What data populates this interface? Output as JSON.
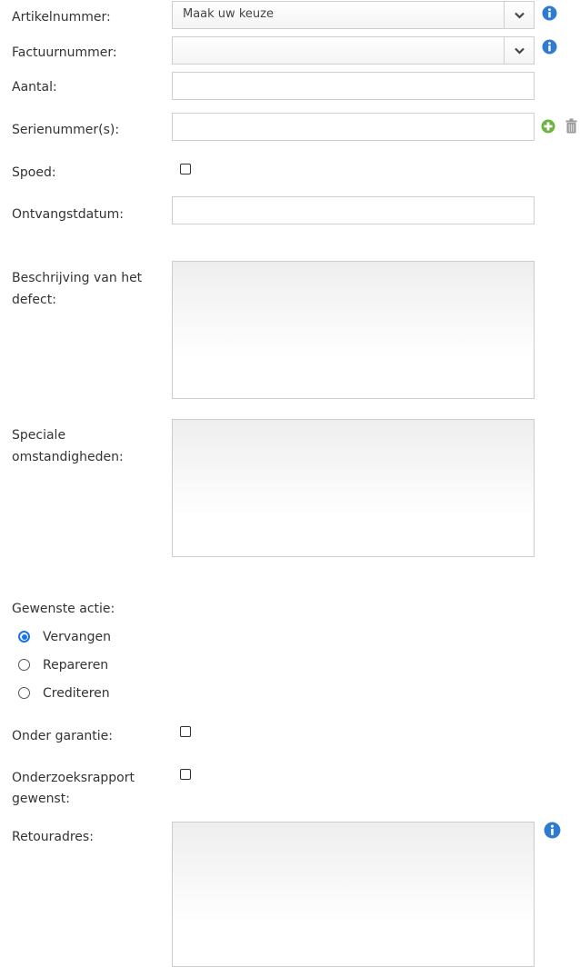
{
  "form": {
    "artikelnummer": {
      "label": "Artikelnummer:",
      "selected": "Maak uw keuze",
      "info_icon": "info-icon",
      "dropdown_icon": "chevron-down-icon"
    },
    "factuurnummer": {
      "label": "Factuurnummer:",
      "selected": "",
      "info_icon": "info-icon",
      "dropdown_icon": "chevron-down-icon"
    },
    "aantal": {
      "label": "Aantal:",
      "value": ""
    },
    "serienummers": {
      "label": "Serienummer(s):",
      "value": "",
      "add_icon": "plus-circle-icon",
      "delete_icon": "trash-icon"
    },
    "spoed": {
      "label": "Spoed:",
      "checked": false
    },
    "ontvangstdatum": {
      "label": "Ontvangstdatum:",
      "value": ""
    },
    "beschrijving": {
      "label_line1": "Beschrijving van het",
      "label_line2": "defect:",
      "value": ""
    },
    "speciale": {
      "label_line1": "Speciale",
      "label_line2": "omstandigheden:",
      "value": ""
    },
    "gewenste_actie": {
      "label": "Gewenste actie:",
      "options": [
        "Vervangen",
        "Repareren",
        "Crediteren"
      ],
      "selected": "Vervangen"
    },
    "onder_garantie": {
      "label": "Onder garantie:",
      "checked": false
    },
    "onderzoeksrapport": {
      "label_line1": "Onderzoeksrapport",
      "label_line2": "gewenst:",
      "checked": false
    },
    "retouradres": {
      "label": "Retouradres:",
      "value": "",
      "info_icon": "info-icon"
    }
  },
  "colors": {
    "info_blue": "#2f7bd1",
    "add_green": "#6cb33f",
    "trash_gray": "#9a9a9a",
    "radio_blue": "#1a73e8",
    "border": "#cfcfcf"
  }
}
